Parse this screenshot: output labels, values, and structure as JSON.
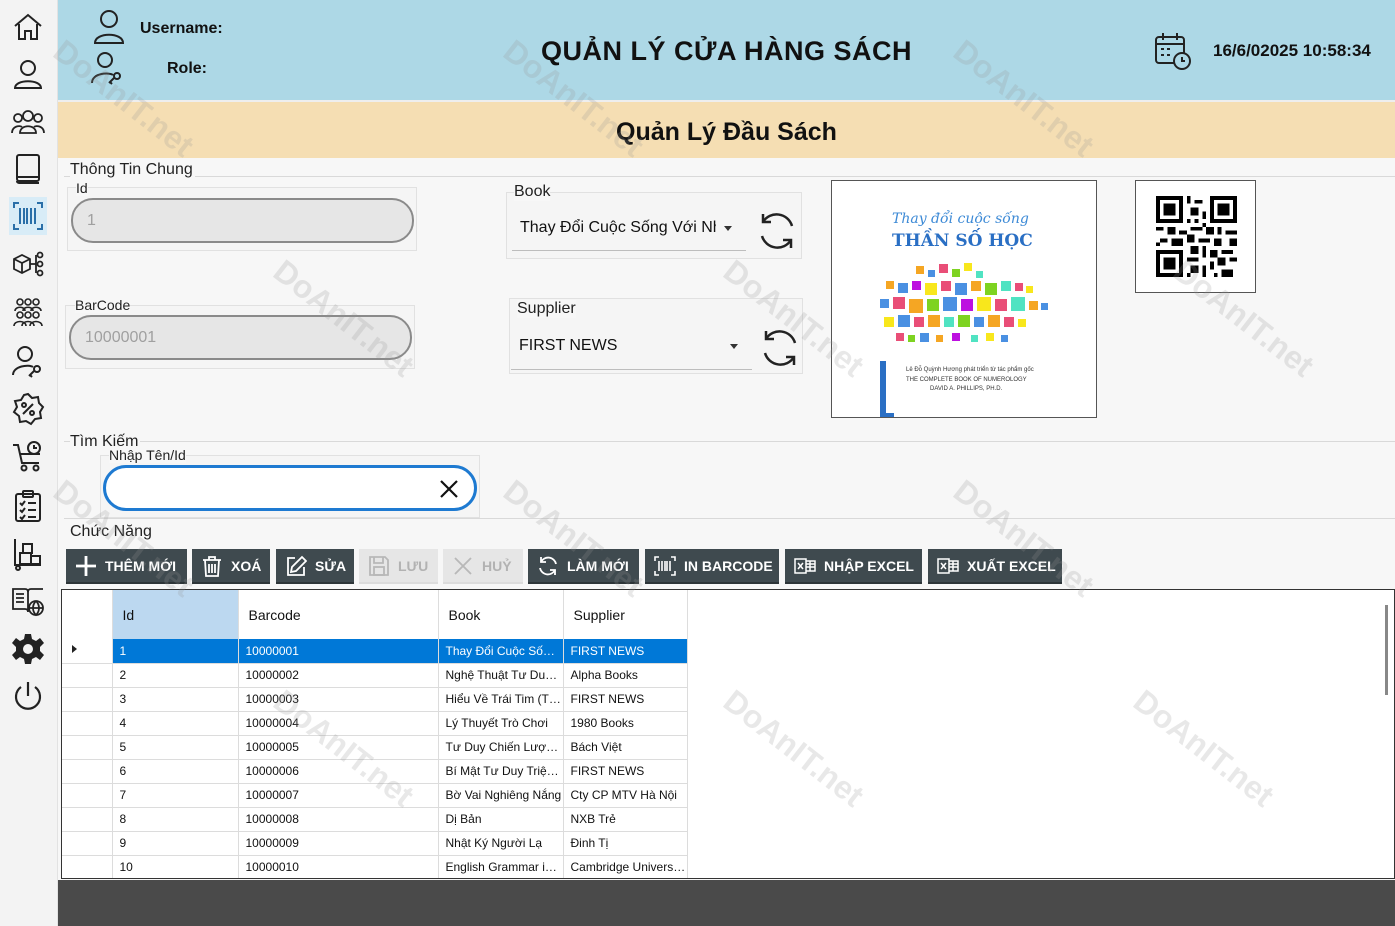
{
  "header": {
    "username_label": "Username:",
    "role_label": "Role:",
    "app_title": "QUẢN LÝ CỬA HÀNG SÁCH",
    "datetime": "16/6/02025 10:58:34"
  },
  "page_title": "Quản Lý Đầu Sách",
  "general": {
    "group_title": "Thông Tin Chung",
    "id_label": "Id",
    "id_value": "1",
    "barcode_label": "BarCode",
    "barcode_value": "10000001",
    "book_label": "Book",
    "book_value": "Thay Đổi Cuộc Sống Với Nh",
    "supplier_label": "Supplier",
    "supplier_value": "FIRST NEWS"
  },
  "cover": {
    "title_line1": "Thay đổi cuộc sống",
    "title_line2": "THẦN SỐ HỌC",
    "author_vi": "Lê Đỗ Quỳnh Hương phát triển từ tác phẩm gốc",
    "book_en": "THE COMPLETE BOOK OF NUMEROLOGY",
    "author_en": "DAVID A. PHILLIPS, PH.D."
  },
  "search": {
    "group_title": "Tìm Kiếm",
    "field_label": "Nhập Tên/Id",
    "value": ""
  },
  "functions": {
    "group_title": "Chức Năng",
    "buttons": {
      "add": "THÊM MỚI",
      "delete": "XOÁ",
      "edit": "SỬA",
      "save": "LƯU",
      "cancel": "HUỶ",
      "refresh": "LÀM MỚI",
      "print_barcode": "IN BARCODE",
      "import_excel": "NHẬP EXCEL",
      "export_excel": "XUẤT EXCEL"
    }
  },
  "table": {
    "columns": [
      "Id",
      "Barcode",
      "Book",
      "Supplier"
    ],
    "rows": [
      [
        "1",
        "10000001",
        "Thay Đổi Cuộc Sống Với Nhân Số Học",
        "FIRST NEWS"
      ],
      [
        "2",
        "10000002",
        "Nghệ Thuật Tư Duy Rành Mạch",
        "Alpha Books"
      ],
      [
        "3",
        "10000003",
        "Hiểu Về Trái Tim (Tái Bản)",
        "FIRST NEWS"
      ],
      [
        "4",
        "10000004",
        "Lý Thuyết Trò Chơi",
        "1980 Books"
      ],
      [
        "5",
        "10000005",
        "Tư Duy Chiến Lược - Lý Thuyết",
        "Bách Việt"
      ],
      [
        "6",
        "10000006",
        "Bí Mật Tư Duy Triệu Phú",
        "FIRST NEWS"
      ],
      [
        "7",
        "10000007",
        "Bờ Vai Nghiêng Nắng",
        "Cty CP MTV Hà Nội"
      ],
      [
        "8",
        "10000008",
        "Dị Bản",
        "NXB Trẻ"
      ],
      [
        "9",
        "10000009",
        "Nhật Ký Người Lạ",
        "Đinh Tị"
      ],
      [
        "10",
        "10000010",
        "English Grammar in Use",
        "Cambridge University Press"
      ]
    ]
  },
  "colors": {
    "header_bg": "#add8e6",
    "subheader_bg": "#f5deb3",
    "button_bg": "#3f4a4f",
    "selection": "#0078d7",
    "search_border": "#1e7ad1"
  }
}
